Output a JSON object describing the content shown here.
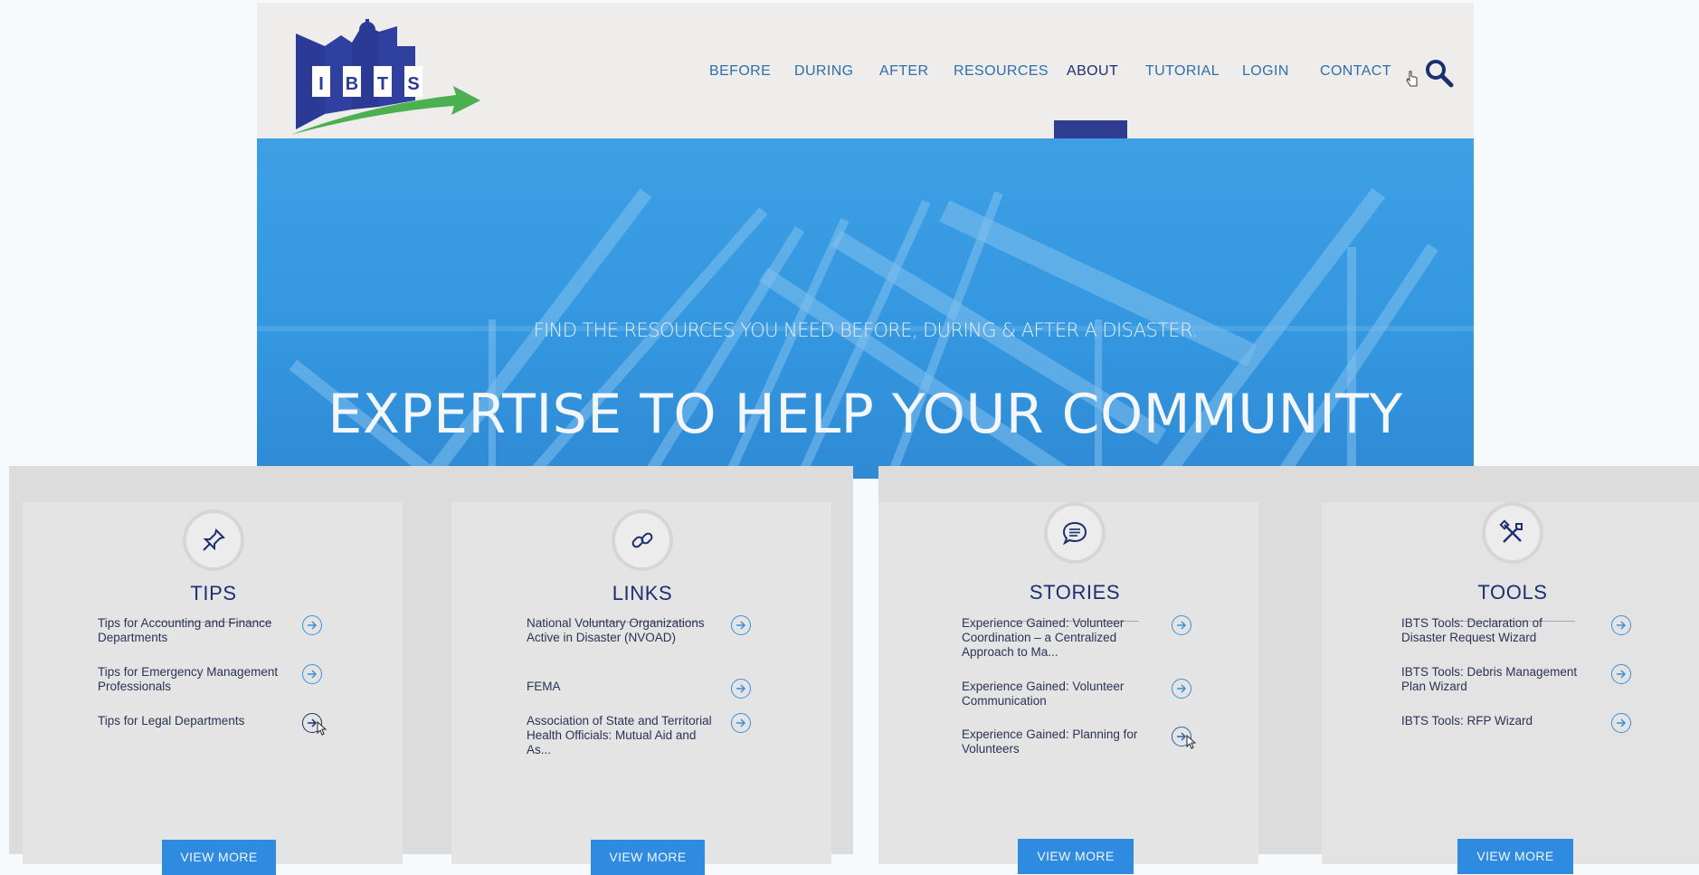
{
  "header": {
    "logo_text": "IBTS",
    "nav": [
      "BEFORE",
      "DURING",
      "AFTER",
      "RESOURCES",
      "ABOUT",
      "TUTORIAL",
      "LOGIN",
      "CONTACT"
    ],
    "active_item": "ABOUT",
    "search_icon": "search-icon"
  },
  "hero": {
    "subtitle": "FIND THE RESOURCES YOU NEED BEFORE, DURING & AFTER A DISASTER.",
    "title": "EXPERTISE TO HELP YOUR COMMUNITY"
  },
  "cards": [
    {
      "title": "TIPS",
      "icon": "pushpin-icon",
      "items": [
        "Tips for Accounting and Finance Departments",
        "Tips for Emergency Management Professionals",
        "Tips for Legal Departments"
      ],
      "button": "VIEW MORE"
    },
    {
      "title": "LINKS",
      "icon": "link-icon",
      "items": [
        "National Voluntary Organizations Active in Disaster (NVOAD)",
        "FEMA",
        "Association of State and Territorial Health Officials: Mutual Aid and As..."
      ],
      "button": "VIEW MORE"
    },
    {
      "title": "STORIES",
      "icon": "speech-bubble-icon",
      "items": [
        "Experience Gained: Volunteer Coordination – a Centralized Approach to Ma...",
        "Experience Gained: Volunteer Communication",
        "Experience Gained: Planning for Volunteers"
      ],
      "button": "VIEW MORE"
    },
    {
      "title": "TOOLS",
      "icon": "tools-icon",
      "items": [
        "IBTS Tools: Declaration of Disaster Request Wizard",
        "IBTS Tools: Debris Management Plan Wizard",
        "IBTS Tools: RFP Wizard"
      ],
      "button": "VIEW MORE"
    }
  ],
  "colors": {
    "brand_navy": "#1c2f6e",
    "brand_blue": "#2f8be0",
    "brand_green": "#4caf50",
    "hero_blue": "#3498e0"
  }
}
